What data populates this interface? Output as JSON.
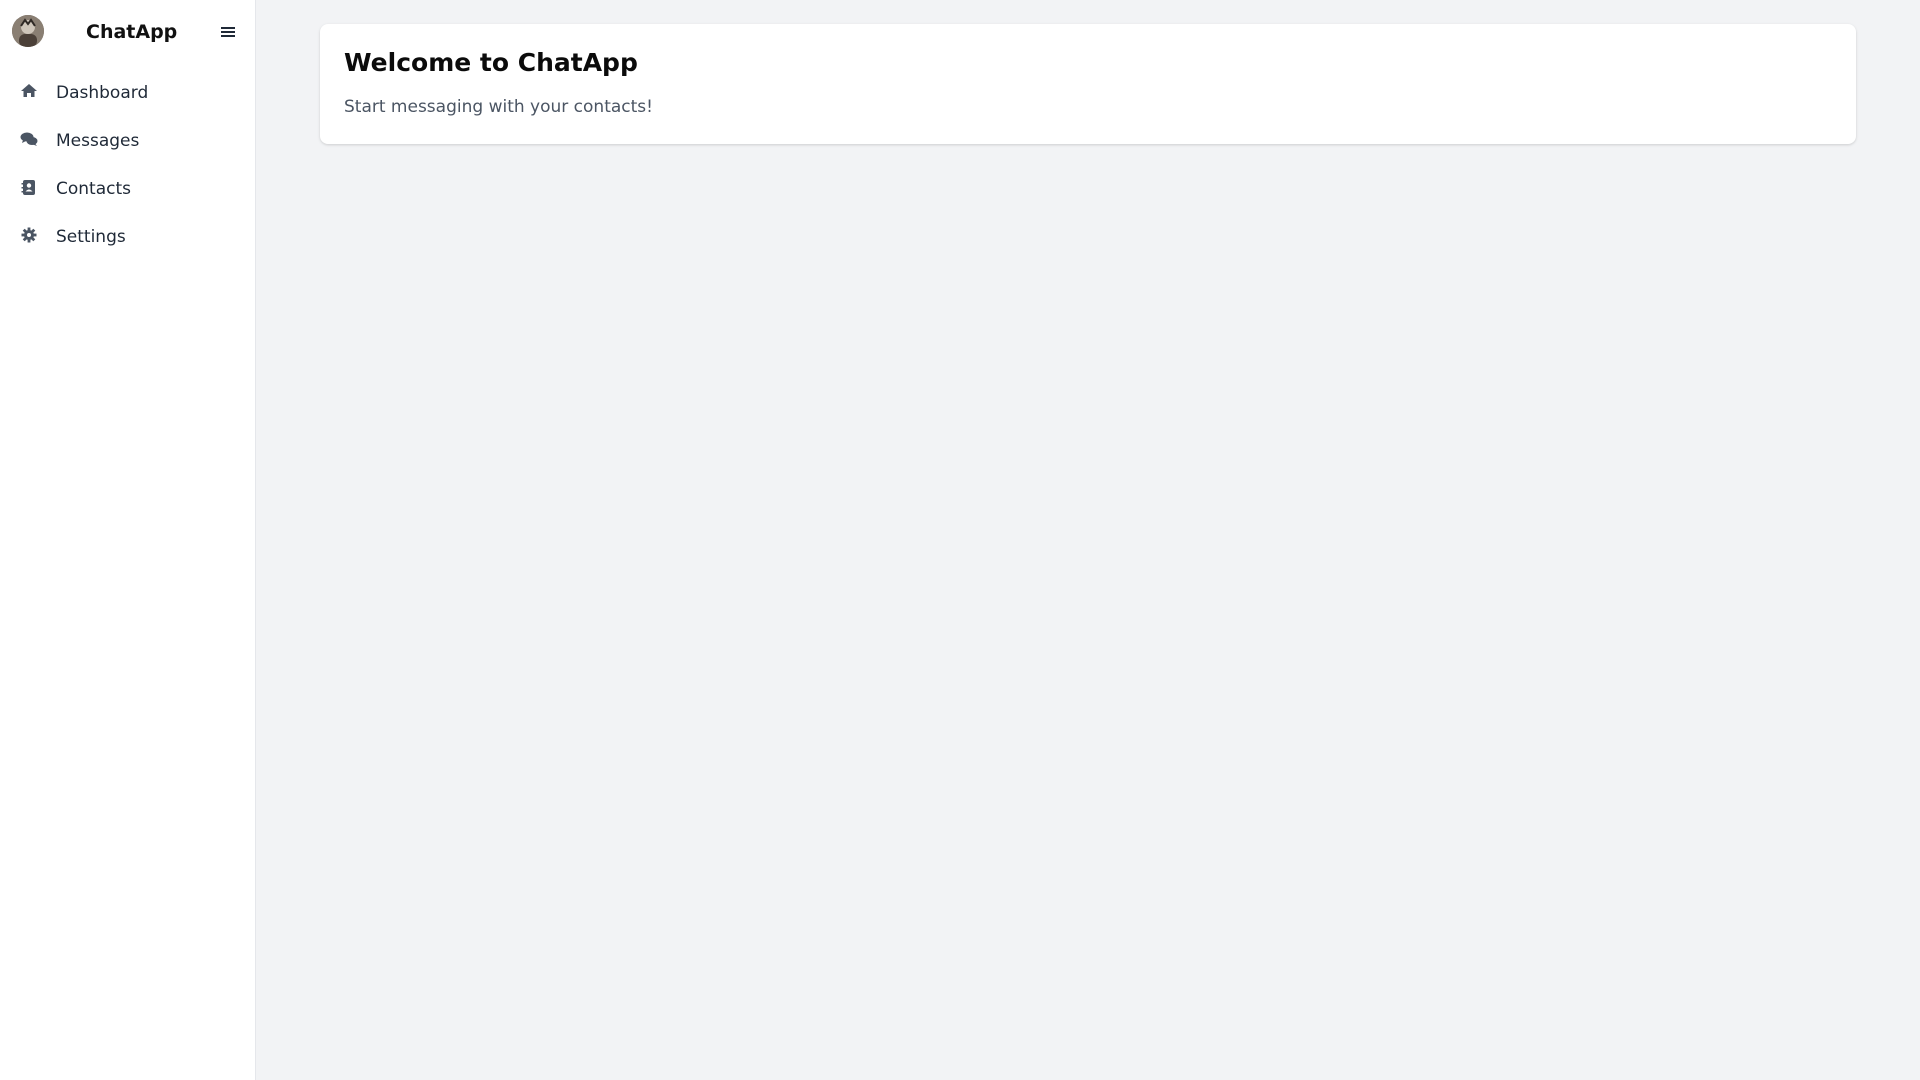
{
  "app": {
    "brand": "ChatApp"
  },
  "icons": {
    "avatar": "user-avatar",
    "menu": "hamburger-menu-icon",
    "dashboard": "home-icon",
    "messages": "chat-bubbles-icon",
    "contacts": "address-book-icon",
    "settings": "gear-icon"
  },
  "sidebar": {
    "items": [
      {
        "label": "Dashboard",
        "icon": "home-icon"
      },
      {
        "label": "Messages",
        "icon": "chat-bubbles-icon"
      },
      {
        "label": "Contacts",
        "icon": "address-book-icon"
      },
      {
        "label": "Settings",
        "icon": "gear-icon"
      }
    ]
  },
  "main": {
    "welcome_title": "Welcome to ChatApp",
    "welcome_text": "Start messaging with your contacts!"
  },
  "colors": {
    "page_background": "#f2f3f5",
    "sidebar_background": "#ffffff",
    "card_background": "#ffffff",
    "icon_color": "#4b5563",
    "text_primary": "#111111",
    "text_secondary": "#4b5563"
  }
}
